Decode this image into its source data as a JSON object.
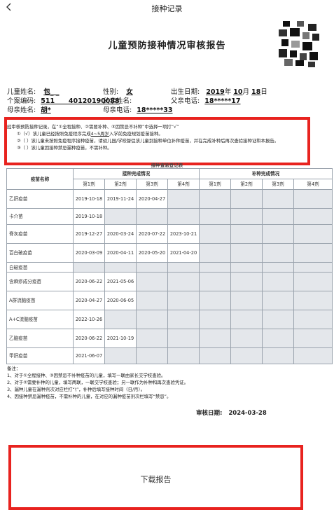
{
  "header": {
    "title": "接种记录"
  },
  "report": {
    "title": "儿童预防接种情况审核报告"
  },
  "info": {
    "name_label": "儿童姓名:",
    "name_value": "包_ _",
    "gender_label": "性别:",
    "gender_value": "女",
    "dob_label": "出生日期:",
    "dob_year": "2019",
    "dob_y": "年",
    "dob_month": "10",
    "dob_m": "月",
    "dob_day": "18",
    "dob_d": "日",
    "id_label": "个案编码:",
    "id_value": "511      40120190088",
    "father_label": "父亲姓名:",
    "father_value": "",
    "father_phone_label": "父亲电话:",
    "father_phone_value": "18*****17",
    "mother_label": "母亲姓名:",
    "mother_value": "胡*",
    "mother_phone_label": "母亲电话:",
    "mother_phone_value": "18*****33"
  },
  "notice": {
    "intro": "经审核预防接种记录，在“①全程接种、②需要补种、③因禁忌不补种”中选择一项打“√”",
    "item1_prefix": "①（√）该儿童已经按照免疫程序完成",
    "item1_underlined": "4~5周岁",
    "item1_suffix": "入学前免疫规划疫苗接种。",
    "item2": "②（ ）该儿童未按照免疫程序接种疫苗，请幼儿园/学校督促该儿童到接种单位补种疫苗，并在完成补种后再次查验接种证和本报告。",
    "item3": "③（ ）该儿童因接种禁忌漏种疫苗，不需补种。"
  },
  "table": {
    "caption": "接种查验登记表",
    "vaccine_col": "疫苗名称",
    "completed_group": "接种完成情况",
    "catchup_group": "补种完成情况",
    "dose_headers": [
      "第1剂",
      "第2剂",
      "第3剂",
      "第4剂"
    ],
    "rows": [
      {
        "name": "乙肝疫苗",
        "doses": [
          "2019-10-18",
          "2019-11-24",
          "2020-04-27",
          ""
        ]
      },
      {
        "name": "卡介苗",
        "doses": [
          "2019-10-18",
          "",
          "",
          ""
        ]
      },
      {
        "name": "脊灰疫苗",
        "doses": [
          "2019-12-27",
          "2020-03-24",
          "2020-07-22",
          "2023-10-21"
        ]
      },
      {
        "name": "百白破疫苗",
        "doses": [
          "2020-03-09",
          "2020-04-11",
          "2020-05-20",
          "2021-04-20"
        ]
      },
      {
        "name": "白破疫苗",
        "doses": [
          "",
          "",
          "",
          ""
        ]
      },
      {
        "name": "含麻疹成分疫苗",
        "doses": [
          "2020-06-22",
          "2021-05-06",
          "",
          ""
        ]
      },
      {
        "name": "A群流脑疫苗",
        "doses": [
          "2020-04-27",
          "2020-06-05",
          "",
          ""
        ]
      },
      {
        "name": "A+C流脑疫苗",
        "doses": [
          "2022-10-26",
          "",
          "",
          ""
        ]
      },
      {
        "name": "乙脑疫苗",
        "doses": [
          "2020-06-22",
          "2021-10-19",
          "",
          ""
        ]
      },
      {
        "name": "甲肝疫苗",
        "doses": [
          "2021-06-07",
          "",
          "",
          ""
        ]
      }
    ]
  },
  "notes": {
    "heading": "备注：",
    "lines": [
      "1、对于①全程接种、③因禁忌不补种疫苗的儿童，填写一联由家长交学校查验。",
      "2、对于②需要补种的儿童，填写两联，一联交学校查验；另一联作为补种和再次查验凭证。",
      "3、漏种儿童在漏种剂次对应栏打“\\”，补种后填写接种时间（日/月）。",
      "4、因接种禁忌漏种疫苗，不需补种的儿童，在对应的漏种疫苗剂次栏填写“禁忌”。"
    ]
  },
  "audit": {
    "label": "审核日期:",
    "date": "2024-03-28"
  },
  "actions": {
    "download_label": "下载报告"
  },
  "colors": {
    "highlight_border": "#e8231f",
    "empty_cell": "#e4e7eb",
    "grid_line": "#9aa3ad"
  },
  "icons": {
    "back": "chevron-left-icon",
    "qr": "qr-code-icon"
  }
}
